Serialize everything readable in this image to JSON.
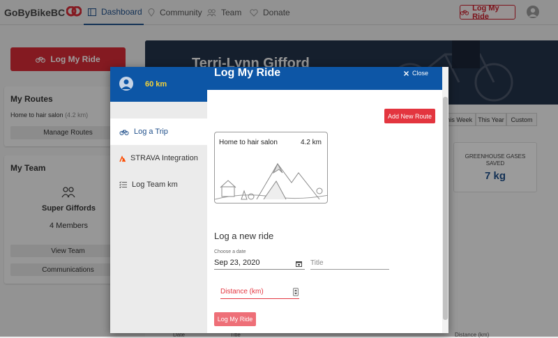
{
  "brand": {
    "name": "GoByBikeBC",
    "red": "#d52b36",
    "blue": "#0d56a6"
  },
  "nav": {
    "items": [
      {
        "label": "Dashboard",
        "icon": "dashboard-icon"
      },
      {
        "label": "Community",
        "icon": "location-icon"
      },
      {
        "label": "Team",
        "icon": "team-icon"
      },
      {
        "label": "Donate",
        "icon": "heart-icon"
      }
    ],
    "log_ride": "Log My Ride"
  },
  "sidebar": {
    "log_ride": "Log My Ride",
    "routes": {
      "title": "My Routes",
      "route_name": "Home to hair salon",
      "route_km": "(4.2 km)",
      "manage": "Manage Routes"
    },
    "team": {
      "title": "My Team",
      "name": "Super Giffords",
      "members": "4 Members",
      "view": "View Team",
      "comms": "Communications"
    }
  },
  "profile": {
    "name": "Terri-Lynn Gifford"
  },
  "period": {
    "tabs": [
      "This Week",
      "This Year",
      "Custom"
    ]
  },
  "stats": {
    "label": "GREENHOUSE GASES SAVED",
    "value": "7 kg"
  },
  "table": {
    "headers": [
      "Date",
      "Title",
      "Distance (km)"
    ]
  },
  "modal": {
    "km": "60 km",
    "title": "Log My Ride",
    "close": "Close",
    "tabs": [
      {
        "label": "Log a Trip",
        "icon": "bike-icon"
      },
      {
        "label": "STRAVA Integration",
        "icon": "strava-icon"
      },
      {
        "label": "Log Team km",
        "icon": "list-icon"
      }
    ],
    "add_route": "Add New Route",
    "route": {
      "name": "Home to hair salon",
      "km": "4.2 km"
    },
    "form_title": "Log a new ride",
    "date_label": "Choose a date",
    "date_value": "Sep 23, 2020",
    "title_placeholder": "Title",
    "distance_placeholder": "Distance (km)",
    "submit": "Log My Ride"
  }
}
